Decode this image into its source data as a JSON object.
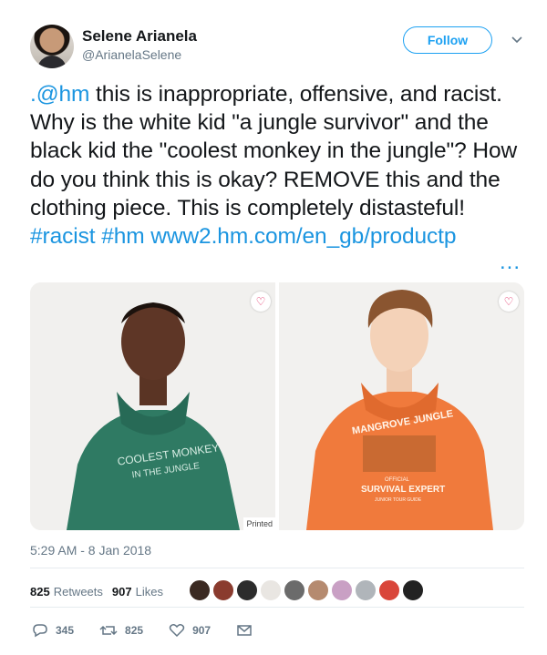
{
  "user": {
    "name": "Selene Arianela",
    "handle": "@ArianelaSelene"
  },
  "follow_label": "Follow",
  "tweet": {
    "parts": [
      {
        "text": ".@hm",
        "link": true
      },
      {
        "text": " this is inappropriate, offensive, and racist. Why is the white kid \"a jungle survivor\" and the black kid the \"coolest monkey in the jungle\"? How do you think this is okay? REMOVE this and the clothing piece. This is completely distasteful! ",
        "link": false
      },
      {
        "text": "#racist",
        "link": true
      },
      {
        "text": " ",
        "link": false
      },
      {
        "text": "#hm",
        "link": true
      },
      {
        "text": " ",
        "link": false
      },
      {
        "text": "www2.hm.com/en_gb/productp",
        "link": true
      }
    ],
    "more": "..."
  },
  "media": {
    "left": {
      "hoodie_text": [
        "COOLEST MONKEY",
        "IN THE JUNGLE"
      ],
      "hoodie_color": "#2f7a63"
    },
    "right": {
      "hoodie_text": [
        "MANGROVE JUNGLE",
        "OFFICIAL",
        "SURVIVAL EXPERT",
        "JUNIOR TOUR GUIDE"
      ],
      "hoodie_color": "#f07a3c"
    },
    "printed_label": "Printed"
  },
  "timestamp": "5:29 AM - 8 Jan 2018",
  "stats": {
    "retweets": "825",
    "retweets_label": "Retweets",
    "likes": "907",
    "likes_label": "Likes"
  },
  "liker_colors": [
    "#3b2a22",
    "#8a3b2e",
    "#2c2c2c",
    "#e9e6e2",
    "#6b6b6b",
    "#b58a6f",
    "#c9a0c4",
    "#b0b5ba",
    "#d9463a",
    "#222222"
  ],
  "actions": {
    "replies": "345",
    "retweets": "825",
    "likes": "907"
  },
  "colors": {
    "accent": "#1da1f2",
    "link": "#1b95e0",
    "muted": "#657786",
    "heart": "#e0245e"
  },
  "icons": [
    "chevron-down-icon",
    "heart-icon",
    "reply-icon",
    "retweet-icon",
    "like-icon",
    "message-icon"
  ]
}
